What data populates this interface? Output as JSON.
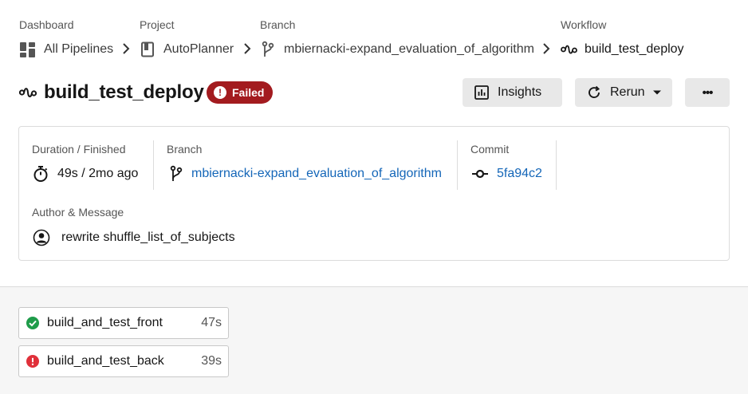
{
  "breadcrumb": {
    "dashboard": {
      "label": "Dashboard",
      "value": "All Pipelines"
    },
    "project": {
      "label": "Project",
      "value": "AutoPlanner"
    },
    "branch": {
      "label": "Branch",
      "value": "mbiernacki-expand_evaluation_of_algorithm"
    },
    "workflow": {
      "label": "Workflow",
      "value": "build_test_deploy"
    }
  },
  "header": {
    "title": "build_test_deploy",
    "status": "Failed",
    "insights_label": "Insights",
    "rerun_label": "Rerun",
    "more_label": "•••"
  },
  "details": {
    "duration": {
      "label": "Duration / Finished",
      "value": "49s / 2mo ago"
    },
    "branch": {
      "label": "Branch",
      "value": "mbiernacki-expand_evaluation_of_algorithm"
    },
    "commit": {
      "label": "Commit",
      "value": "5fa94c2"
    },
    "author": {
      "label": "Author & Message",
      "value": "rewrite shuffle_list_of_subjects"
    }
  },
  "jobs": [
    {
      "name": "build_and_test_front",
      "duration": "47s",
      "status": "success"
    },
    {
      "name": "build_and_test_back",
      "duration": "39s",
      "status": "failed"
    }
  ],
  "colors": {
    "failed_badge": "#a31b1f",
    "success_green": "#1f9c4a",
    "error_red": "#e0303a",
    "link_blue": "#1466b8"
  }
}
